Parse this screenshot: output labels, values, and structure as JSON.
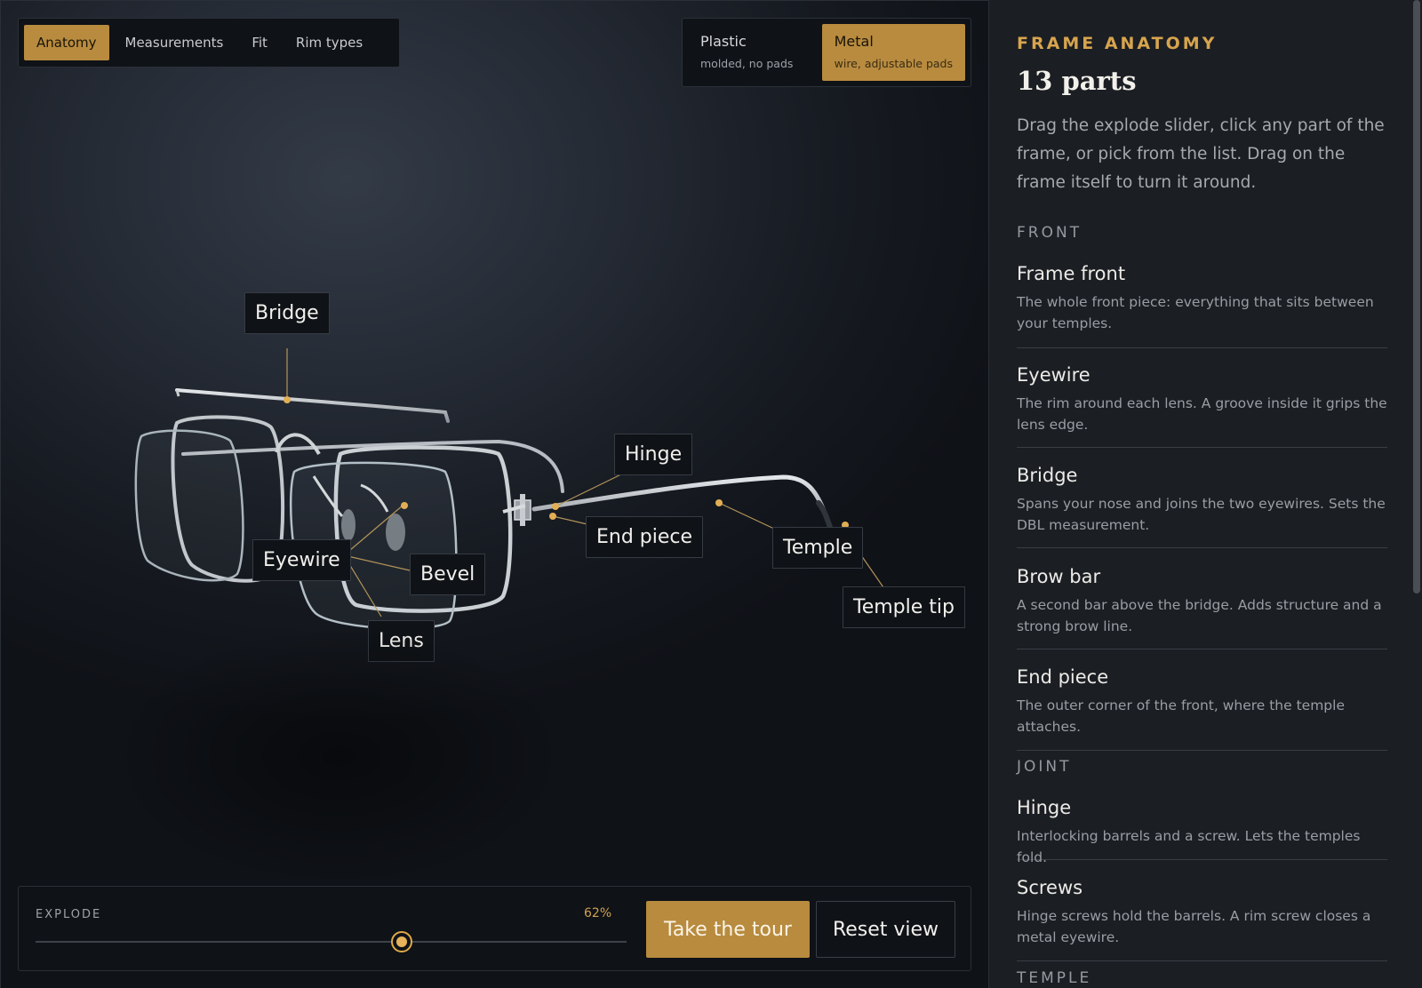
{
  "tabs": [
    {
      "label": "Anatomy",
      "active": true
    },
    {
      "label": "Measurements",
      "active": false
    },
    {
      "label": "Fit",
      "active": false
    },
    {
      "label": "Rim types",
      "active": false
    }
  ],
  "material": {
    "options": [
      {
        "name": "Plastic",
        "sub": "molded, no pads",
        "active": false
      },
      {
        "name": "Metal",
        "sub": "wire, adjustable pads",
        "active": true
      }
    ]
  },
  "callouts": {
    "bridge": "Bridge",
    "hinge": "Hinge",
    "end_piece": "End piece",
    "temple": "Temple",
    "temple_tip": "Temple tip",
    "eyewire": "Eyewire",
    "bevel": "Bevel",
    "lens": "Lens"
  },
  "controls": {
    "explode_label": "EXPLODE",
    "explode_value": 62,
    "explode_text": "62%",
    "tour_label": "Take the tour",
    "reset_label": "Reset view"
  },
  "panel": {
    "eyebrow": "FRAME ANATOMY",
    "count": "13 parts",
    "intro": "Drag the explode slider, click any part of the frame, or pick from the list. Drag on the frame itself to turn it around.",
    "groups": {
      "front": "FRONT",
      "joint": "JOINT",
      "temple": "TEMPLE"
    },
    "parts": {
      "frame_front": {
        "name": "Frame front",
        "desc": "The whole front piece: everything that sits between your temples."
      },
      "eyewire": {
        "name": "Eyewire",
        "desc": "The rim around each lens. A groove inside it grips the lens edge."
      },
      "bridge": {
        "name": "Bridge",
        "desc": "Spans your nose and joins the two eyewires. Sets the DBL measurement."
      },
      "brow_bar": {
        "name": "Brow bar",
        "desc": "A second bar above the bridge. Adds structure and a strong brow line."
      },
      "end_piece": {
        "name": "End piece",
        "desc": "The outer corner of the front, where the temple attaches."
      },
      "hinge": {
        "name": "Hinge",
        "desc": "Interlocking barrels and a screw. Lets the temples fold."
      },
      "screws": {
        "name": "Screws",
        "desc": "Hinge screws hold the barrels. A rim screw closes a metal eyewire."
      }
    }
  },
  "colors": {
    "accent": "#b88b3f",
    "accent_light": "#d7a44e",
    "panel_bg": "#1b1e23"
  }
}
